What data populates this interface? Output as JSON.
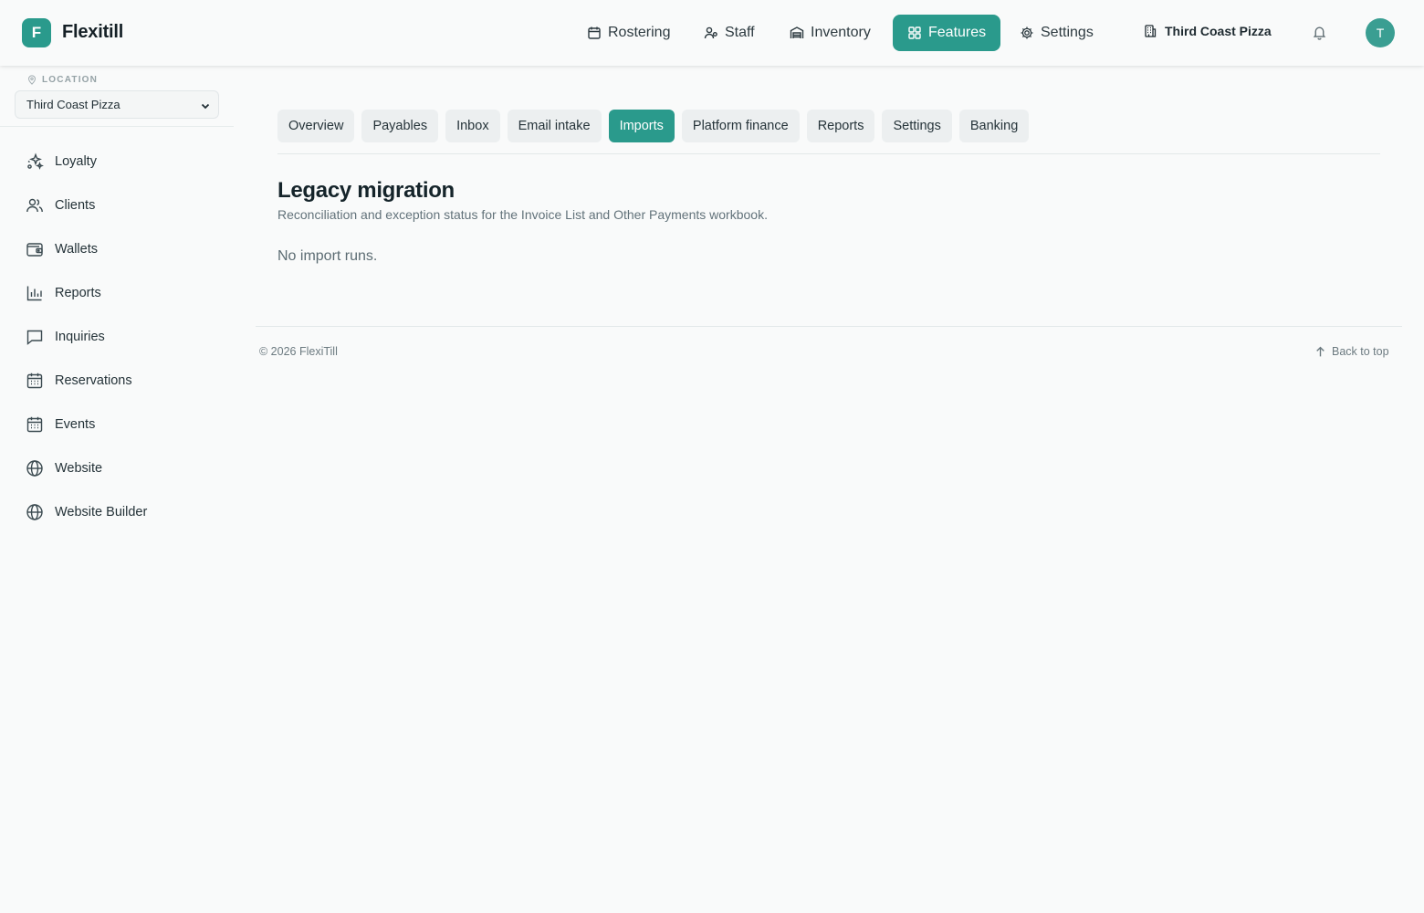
{
  "app": {
    "logo_letter": "F",
    "brand": "Flexitill"
  },
  "topnav": {
    "items": [
      {
        "label": "Rostering",
        "icon": "calendar-icon"
      },
      {
        "label": "Staff",
        "icon": "staff-icon"
      },
      {
        "label": "Inventory",
        "icon": "warehouse-icon"
      },
      {
        "label": "Features",
        "icon": "grid-icon",
        "active": true
      },
      {
        "label": "Settings",
        "icon": "gear-icon"
      }
    ],
    "store_name": "Third Coast Pizza",
    "avatar_initial": "T"
  },
  "sidebar": {
    "location_label": "LOCATION",
    "location_value": "Third Coast Pizza",
    "items": [
      {
        "label": "Loyalty",
        "icon": "sparkles-icon"
      },
      {
        "label": "Clients",
        "icon": "users-icon"
      },
      {
        "label": "Wallets",
        "icon": "wallet-icon"
      },
      {
        "label": "Reports",
        "icon": "bar-chart-icon"
      },
      {
        "label": "Inquiries",
        "icon": "message-icon"
      },
      {
        "label": "Reservations",
        "icon": "calendar-grid-icon"
      },
      {
        "label": "Events",
        "icon": "calendar-grid-icon"
      },
      {
        "label": "Website",
        "icon": "globe-icon"
      },
      {
        "label": "Website Builder",
        "icon": "globe-icon"
      }
    ]
  },
  "tabs": [
    {
      "label": "Overview"
    },
    {
      "label": "Payables"
    },
    {
      "label": "Inbox"
    },
    {
      "label": "Email intake"
    },
    {
      "label": "Imports",
      "active": true
    },
    {
      "label": "Platform finance"
    },
    {
      "label": "Reports"
    },
    {
      "label": "Settings"
    },
    {
      "label": "Banking"
    }
  ],
  "main": {
    "title": "Legacy migration",
    "subtitle": "Reconciliation and exception status for the Invoice List and Other Payments workbook.",
    "empty_message": "No import runs."
  },
  "footer": {
    "copyright": "© 2026 FlexiTill",
    "back_to_top": "Back to top"
  },
  "colors": {
    "accent": "#2a9a8c",
    "background": "#f9fafa"
  }
}
